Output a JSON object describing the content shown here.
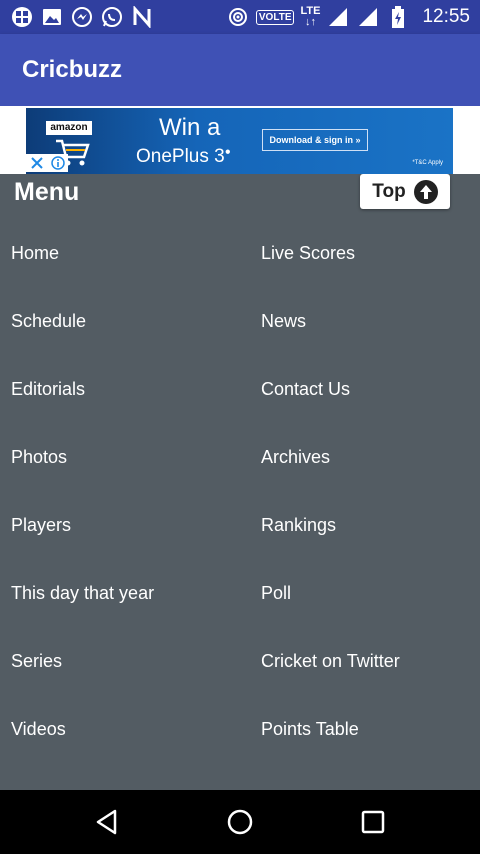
{
  "status_bar": {
    "icons_left": [
      "grid-app-icon",
      "gallery-icon",
      "messenger-icon",
      "whatsapp-icon",
      "n-app-icon"
    ],
    "icons_right": [
      "hotspot-icon",
      "signal-icon",
      "signal-icon",
      "battery-icon"
    ],
    "volte": "VOLTE",
    "network": "LTE",
    "time": "12:55"
  },
  "app_bar": {
    "title": "Cricbuzz"
  },
  "ad": {
    "brand": "amazon",
    "headline": "Win a",
    "product": "OnePlus 3",
    "cta": "Download & sign in »",
    "terms": "*T&C Apply"
  },
  "menu": {
    "title": "Menu",
    "top_label": "Top",
    "items_left": [
      "Home",
      "Schedule",
      "Editorials",
      "Photos",
      "Players",
      "This day that year",
      "Series",
      "Videos"
    ],
    "items_right": [
      "Live Scores",
      "News",
      "Contact Us",
      "Archives",
      "Rankings",
      "Poll",
      "Cricket on Twitter",
      "Points Table"
    ]
  },
  "colors": {
    "status_bar": "#303f9f",
    "app_bar": "#3f51b5",
    "menu_bg": "#535c63",
    "nav_bar": "#000000"
  }
}
